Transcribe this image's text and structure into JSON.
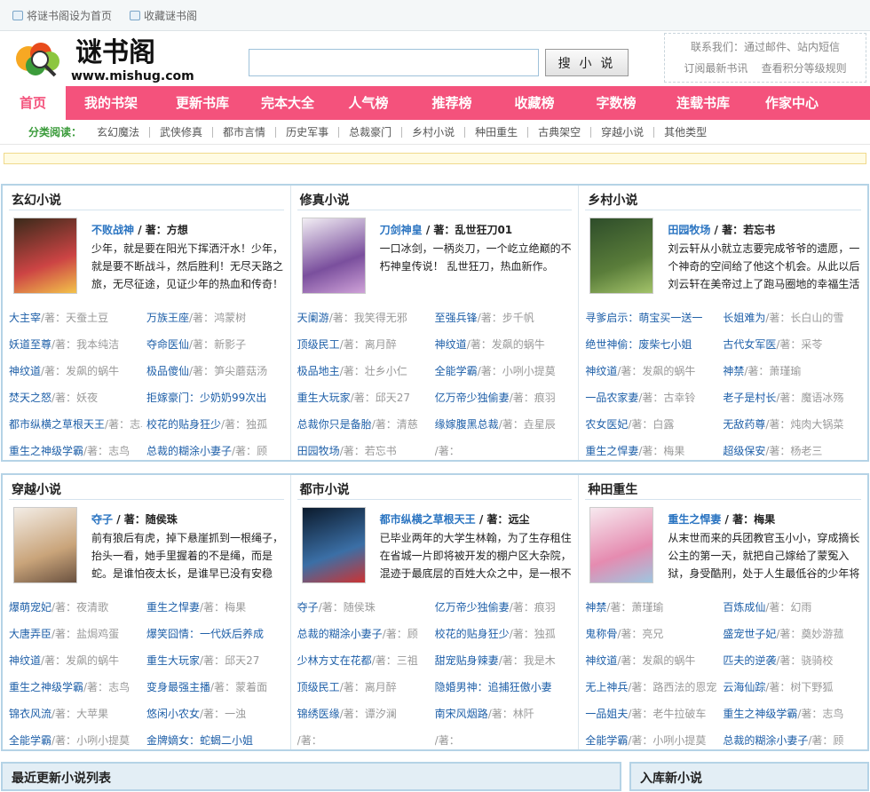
{
  "top": {
    "home": "将谜书阁设为首页",
    "fav": "收藏谜书阁"
  },
  "logo": {
    "cn": "谜书阁",
    "url": "www.mishug.com"
  },
  "search": {
    "value": "",
    "button": "搜 小 说"
  },
  "contact": {
    "line1": "联系我们：通过邮件、站内短信",
    "line2a": "订阅最新书讯",
    "line2b": "查看积分等级规则"
  },
  "nav": [
    {
      "label": "首页",
      "on": true
    },
    {
      "label": "我的书架"
    },
    {
      "label": "更新书库"
    },
    {
      "label": "完本大全"
    },
    {
      "label": "人气榜"
    },
    {
      "label": "推荐榜"
    },
    {
      "label": "收藏榜"
    },
    {
      "label": "字数榜"
    },
    {
      "label": "连载书库"
    },
    {
      "label": "作家中心"
    }
  ],
  "cat": {
    "label": "分类阅读：",
    "items": [
      "玄幻魔法",
      "武侠修真",
      "都市言情",
      "历史军事",
      "总裁豪门",
      "乡村小说",
      "种田重生",
      "古典架空",
      "穿越小说",
      "其他类型"
    ]
  },
  "rows": [
    {
      "cols": [
        {
          "title": "玄幻小说",
          "feat": {
            "name": "不败战神",
            "author": "方想",
            "desc": "少年，就是要在阳光下挥洒汗水！少年，就是要不断战斗，然后胜利！无尽天路之旅，无尽征途，见证少年的热血和传奇！"
          },
          "books": [
            [
              "大主宰",
              "天蚕土豆"
            ],
            [
              "万族王座",
              "鸿蒙树"
            ],
            [
              "妖道至尊",
              "我本纯洁"
            ],
            [
              "夺命医仙",
              "新影子"
            ],
            [
              "神纹道",
              "发飙的蜗牛"
            ],
            [
              "极品傻仙",
              "笋尖蘑菇汤"
            ],
            [
              "焚天之怒",
              "妖夜"
            ],
            [
              "拒嫁豪门：少奶奶99次出",
              ""
            ],
            [
              "都市纵横之草根天王",
              "志鸟"
            ],
            [
              "校花的贴身狂少",
              "独孤"
            ],
            [
              "重生之神级学霸",
              "志鸟"
            ],
            [
              "总裁的糊涂小妻子",
              "顾"
            ]
          ]
        },
        {
          "title": "修真小说",
          "feat": {
            "name": "刀剑神皇",
            "author": "乱世狂刀01",
            "desc": "一口冰剑，一柄炎刀，一个屹立绝巅的不朽神皇传说！ 乱世狂刀，热血新作。"
          },
          "books": [
            [
              "天阑游",
              "我笑得无邪"
            ],
            [
              "至强兵锋",
              "步千帆"
            ],
            [
              "顶级民工",
              "离月醉"
            ],
            [
              "神纹道",
              "发飙的蜗牛"
            ],
            [
              "极品地主",
              "壮乡小仁"
            ],
            [
              "全能学霸",
              "小咧小提莫"
            ],
            [
              "重生大玩家",
              "邱天27"
            ],
            [
              "亿万帝少独偷妻",
              "痕羽"
            ],
            [
              "总裁你只是备胎",
              "清慈"
            ],
            [
              "缘嫁腹黑总裁",
              "垚星辰"
            ],
            [
              "田园牧场",
              "若忘书"
            ],
            [
              "",
              ""
            ]
          ]
        },
        {
          "title": "乡村小说",
          "feat": {
            "name": "田园牧场",
            "author": "若忘书",
            "desc": "刘云轩从小就立志要完成爷爷的遗愿，一个神奇的空间给了他这个机会。从此以后刘云轩在美帝过上了跑马圈地的幸福生活"
          },
          "books": [
            [
              "寻爹启示：萌宝买一送一",
              ""
            ],
            [
              "长姐难为",
              "长白山的雪"
            ],
            [
              "绝世神偷：废柴七小姐",
              ""
            ],
            [
              "古代女军医",
              "采苓"
            ],
            [
              "神纹道",
              "发飙的蜗牛"
            ],
            [
              "神禁",
              "萧瑾瑜"
            ],
            [
              "一品农家妻",
              "古幸铃"
            ],
            [
              "老子是村长",
              "魔语冰殇"
            ],
            [
              "农女医妃",
              "白露"
            ],
            [
              "无敌药尊",
              "炖肉大锅菜"
            ],
            [
              "重生之悍妻",
              "梅果"
            ],
            [
              "超级保安",
              "杨老三"
            ]
          ]
        }
      ]
    },
    {
      "cols": [
        {
          "title": "穿越小说",
          "feat": {
            "name": "夺子",
            "author": "随侯珠",
            "desc": "前有狼后有虎，掉下悬崖抓到一根绳子，抬头一看，她手里握着的不是绳，而是蛇。是谁怕夜太长，是谁早已没有安稳"
          },
          "books": [
            [
              "爆萌宠妃",
              "夜清歌"
            ],
            [
              "重生之悍妻",
              "梅果"
            ],
            [
              "大唐弄臣",
              "盐焗鸡蛋"
            ],
            [
              "爆笑囧情：一代妖后养成",
              ""
            ],
            [
              "神纹道",
              "发飙的蜗牛"
            ],
            [
              "重生大玩家",
              "邱天27"
            ],
            [
              "重生之神级学霸",
              "志鸟"
            ],
            [
              "变身最强主播",
              "蒙着面"
            ],
            [
              "锦衣风流",
              "大苹果"
            ],
            [
              "悠闲小农女",
              "一浊"
            ],
            [
              "全能学霸",
              "小咧小提莫"
            ],
            [
              "金牌嫡女：蛇蝎二小姐",
              ""
            ]
          ]
        },
        {
          "title": "都市小说",
          "feat": {
            "name": "都市纵横之草根天王",
            "author": "远尘",
            "desc": "已毕业两年的大学生林翰，为了生存租住在省城一片即将被开发的棚户区大杂院，混迹于最底层的百姓大众之中，是一根不"
          },
          "books": [
            [
              "夺子",
              "随侯珠"
            ],
            [
              "亿万帝少独偷妻",
              "痕羽"
            ],
            [
              "总裁的糊涂小妻子",
              "顾"
            ],
            [
              "校花的贴身狂少",
              "独孤"
            ],
            [
              "少林方丈在花都",
              "三祖"
            ],
            [
              "甜宠贴身辣妻",
              "我是木"
            ],
            [
              "顶级民工",
              "离月醉"
            ],
            [
              "隐婚男神：追捕狂傲小妻",
              ""
            ],
            [
              "锦绣医缘",
              "谭汐澜"
            ],
            [
              "南宋风烟路",
              "林阡"
            ],
            [
              "",
              ""
            ],
            [
              "",
              ""
            ]
          ]
        },
        {
          "title": "种田重生",
          "feat": {
            "name": "重生之悍妻",
            "author": "梅果",
            "desc": "从末世而来的兵团教官玉小小，穿成摘长公主的第一天，就把自己嫁给了蒙冤入狱，身受酷刑，处于人生最低谷的少年将"
          },
          "books": [
            [
              "神禁",
              "萧瑾瑜"
            ],
            [
              "百炼成仙",
              "幻雨"
            ],
            [
              "鬼称骨",
              "亮兄"
            ],
            [
              "盛宠世子妃",
              "奠妙游菰"
            ],
            [
              "神纹道",
              "发飙的蜗牛"
            ],
            [
              "匹夫的逆袭",
              "骁骑校"
            ],
            [
              "无上神兵",
              "路西法的恩宠"
            ],
            [
              "云海仙踪",
              "树下野狐"
            ],
            [
              "一品姐夫",
              "老牛拉破车"
            ],
            [
              "重生之神级学霸",
              "志鸟"
            ],
            [
              "全能学霸",
              "小咧小提莫"
            ],
            [
              "总裁的糊涂小妻子",
              "顾"
            ]
          ]
        }
      ]
    }
  ],
  "bottom": {
    "left": "最近更新小说列表",
    "right": "入库新小说"
  },
  "labels": {
    "by": "/ 著：",
    "au": "/著："
  }
}
